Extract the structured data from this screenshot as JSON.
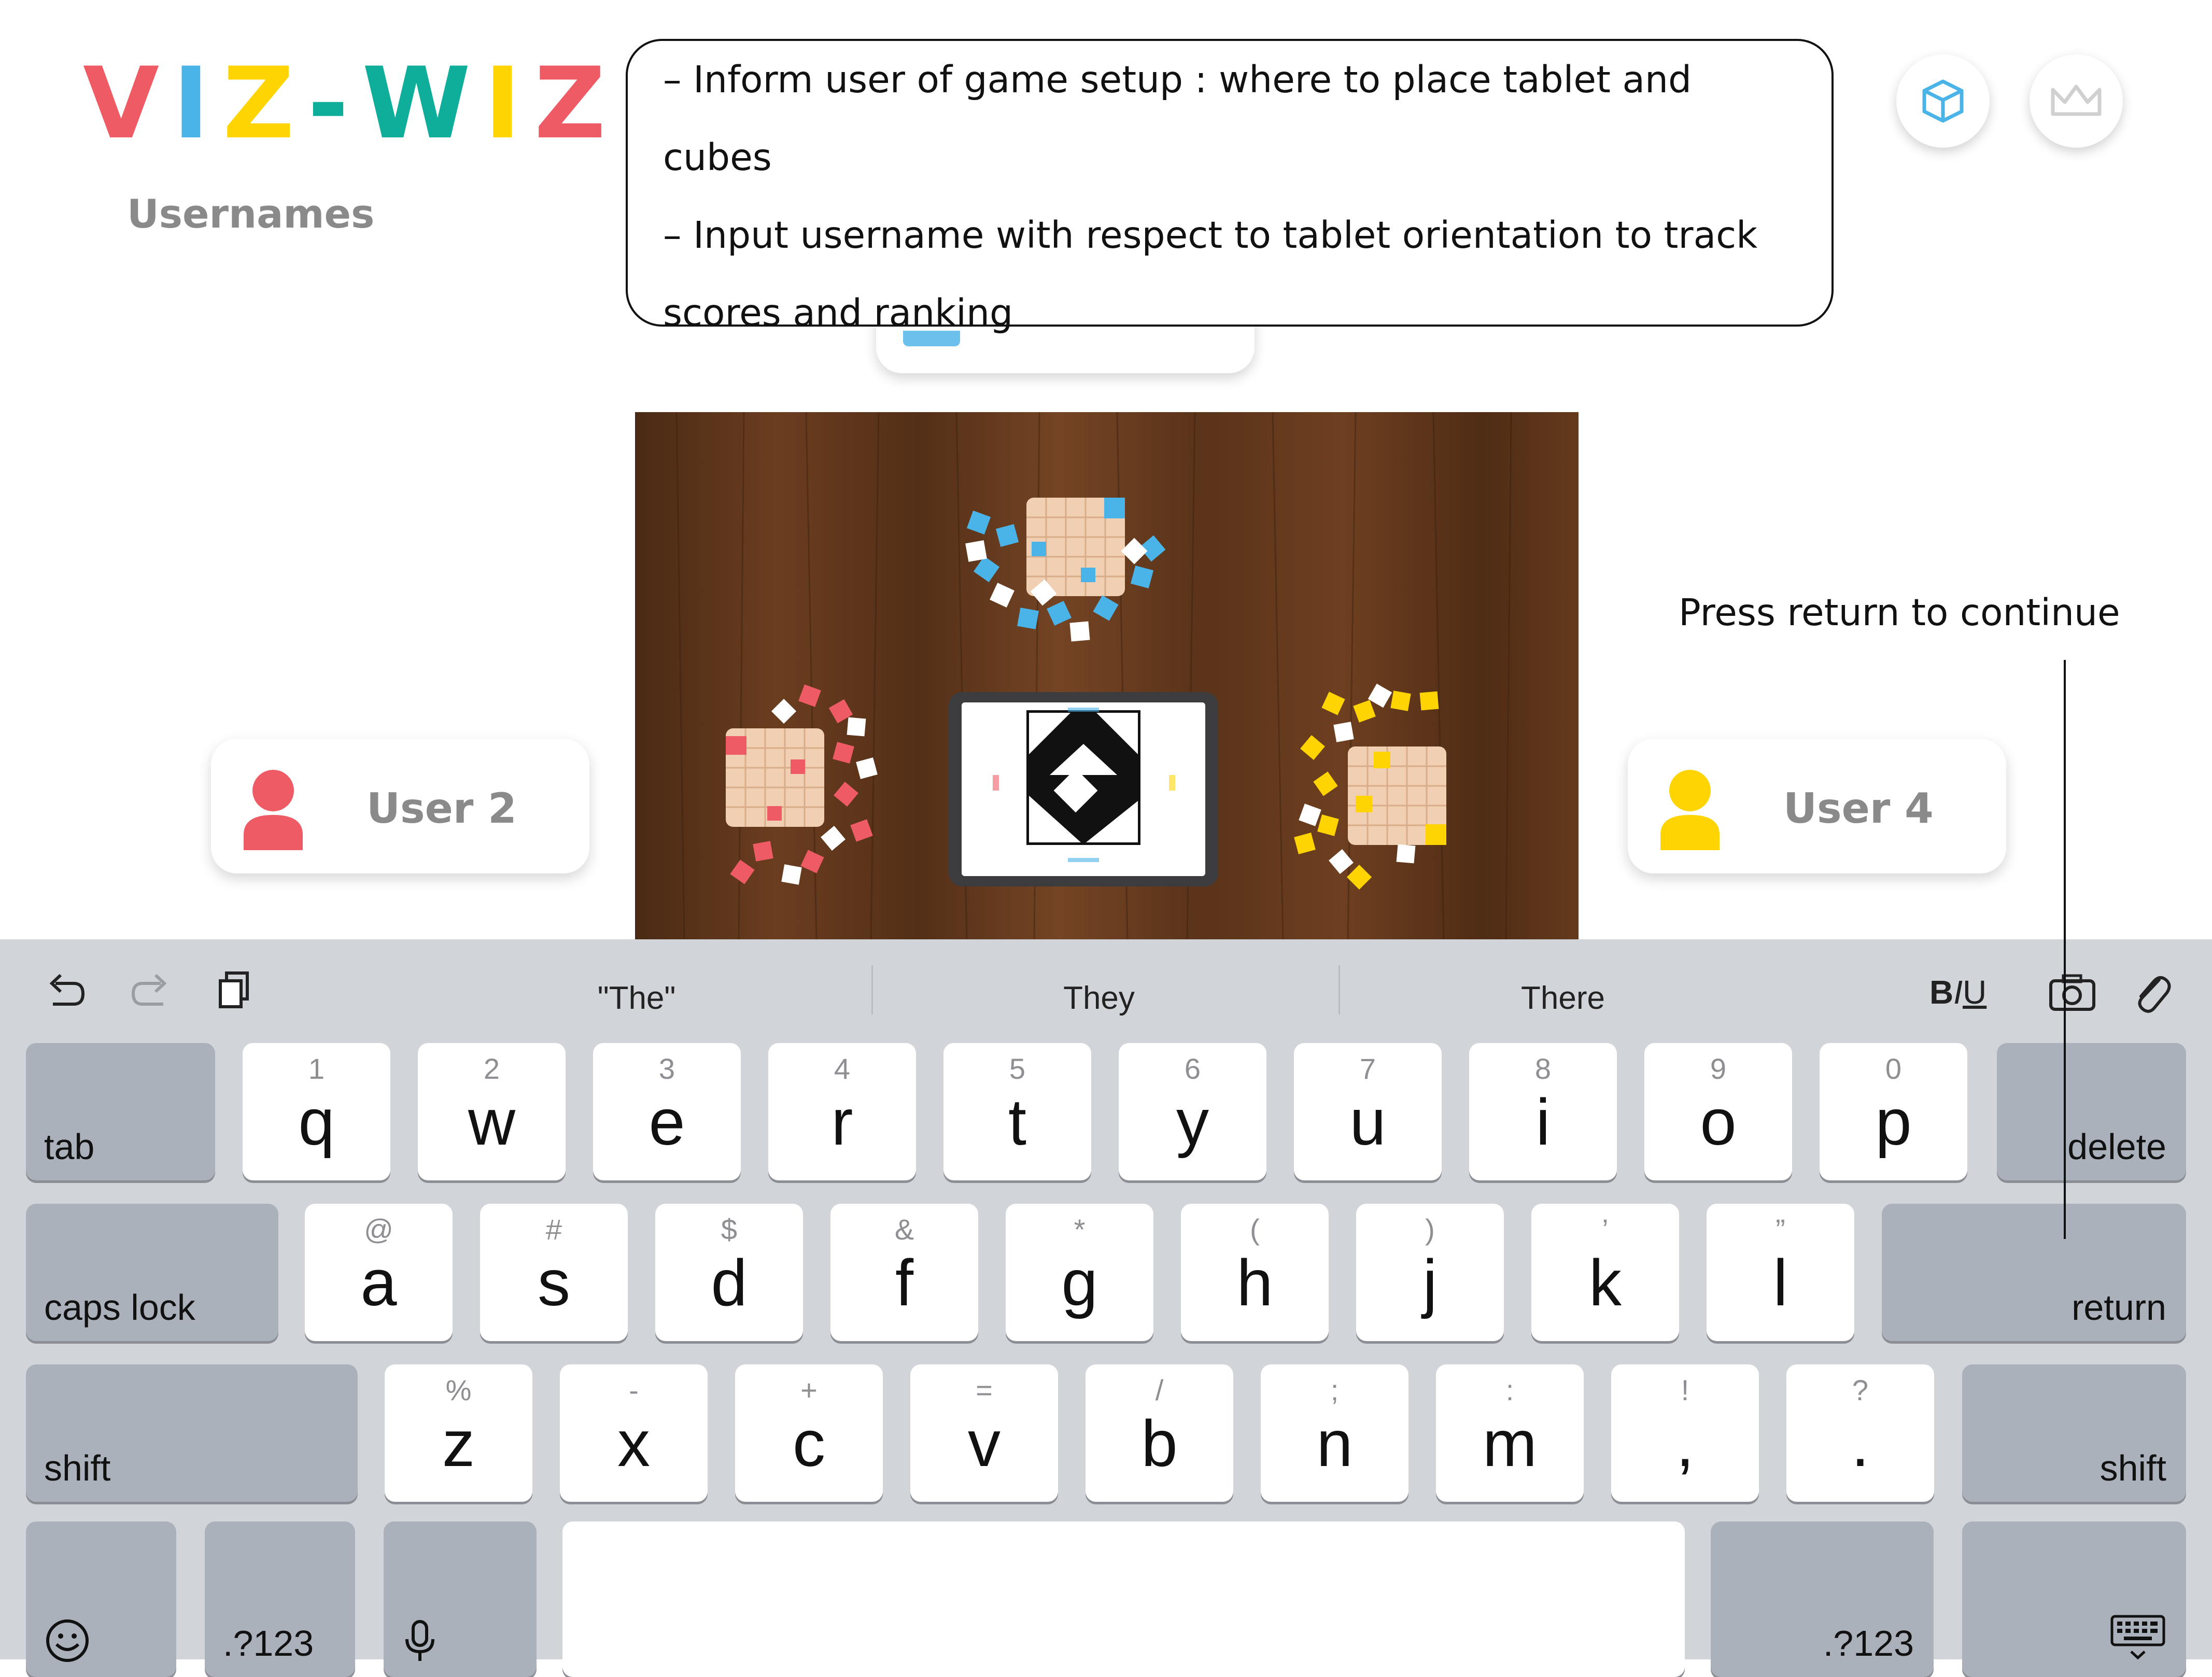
{
  "app": {
    "logo_letters": [
      "V",
      "I",
      "Z",
      "-",
      "W",
      "I",
      "Z"
    ],
    "logo_colors": [
      "#ef5b64",
      "#4ab3e8",
      "#ffd400",
      "#0fae9b",
      "#0fae9b",
      "#ffd400",
      "#ef5b64"
    ],
    "subtitle": "Usernames"
  },
  "annotation": {
    "lines": [
      "– Inform user of game setup : where to place tablet and",
      "cubes",
      "– Input username with respect to tablet orientation to track",
      "scores and ranking"
    ]
  },
  "hint": "Press return to continue",
  "header_buttons": [
    {
      "icon": "cube-icon",
      "color": "#4ab3e8"
    },
    {
      "icon": "crown-icon",
      "color": "#d0d0d0"
    }
  ],
  "users": [
    {
      "name": "User 2",
      "color": "#ef5b64"
    },
    {
      "name": "User 4",
      "color": "#ffd400"
    }
  ],
  "colors": {
    "red": "#ef5b64",
    "blue": "#4ab3e8",
    "yellow": "#ffd400",
    "teal": "#0fae9b",
    "gray_text": "#8a8a8a",
    "keyboard_bg": "#d1d4d9",
    "dark_key": "#abb1ba"
  },
  "keyboard": {
    "suggestions": [
      "\"The\"",
      "They",
      "There"
    ],
    "format_label": "BIU",
    "rows": [
      {
        "left": "tab",
        "right": "delete",
        "keys": [
          {
            "sec": "1",
            "pri": "q"
          },
          {
            "sec": "2",
            "pri": "w"
          },
          {
            "sec": "3",
            "pri": "e"
          },
          {
            "sec": "4",
            "pri": "r"
          },
          {
            "sec": "5",
            "pri": "t"
          },
          {
            "sec": "6",
            "pri": "y"
          },
          {
            "sec": "7",
            "pri": "u"
          },
          {
            "sec": "8",
            "pri": "i"
          },
          {
            "sec": "9",
            "pri": "o"
          },
          {
            "sec": "0",
            "pri": "p"
          }
        ]
      },
      {
        "left": "caps lock",
        "right": "return",
        "keys": [
          {
            "sec": "@",
            "pri": "a"
          },
          {
            "sec": "#",
            "pri": "s"
          },
          {
            "sec": "$",
            "pri": "d"
          },
          {
            "sec": "&",
            "pri": "f"
          },
          {
            "sec": "*",
            "pri": "g"
          },
          {
            "sec": "(",
            "pri": "h"
          },
          {
            "sec": ")",
            "pri": "j"
          },
          {
            "sec": "’",
            "pri": "k"
          },
          {
            "sec": "”",
            "pri": "l"
          }
        ]
      },
      {
        "left": "shift",
        "right": "shift",
        "keys": [
          {
            "sec": "%",
            "pri": "z"
          },
          {
            "sec": "-",
            "pri": "x"
          },
          {
            "sec": "+",
            "pri": "c"
          },
          {
            "sec": "=",
            "pri": "v"
          },
          {
            "sec": "/",
            "pri": "b"
          },
          {
            "sec": ";",
            "pri": "n"
          },
          {
            "sec": ":",
            "pri": "m"
          },
          {
            "sec": "!",
            "pri": ","
          },
          {
            "sec": "?",
            "pri": "."
          }
        ]
      }
    ],
    "bottom": {
      "numbers_left": ".?123",
      "numbers_right": ".?123"
    }
  }
}
